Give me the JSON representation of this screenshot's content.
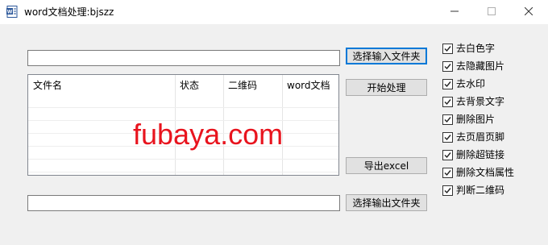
{
  "window": {
    "title": "word文档处理:bjszz"
  },
  "input_folder": {
    "value": "",
    "button_label": "选择输入文件夹"
  },
  "output_folder": {
    "value": "",
    "button_label": "选择输出文件夹"
  },
  "actions": {
    "start_label": "开始处理",
    "export_label": "导出excel"
  },
  "table": {
    "columns": [
      "文件名",
      "状态",
      "二维码",
      "word文档"
    ],
    "rows": []
  },
  "watermark": "fubaya.com",
  "options": [
    {
      "label": "去白色字",
      "checked": true
    },
    {
      "label": "去隐藏图片",
      "checked": true
    },
    {
      "label": "去水印",
      "checked": true
    },
    {
      "label": "去背景文字",
      "checked": true
    },
    {
      "label": "删除图片",
      "checked": true
    },
    {
      "label": "去页眉页脚",
      "checked": true
    },
    {
      "label": "删除超链接",
      "checked": true
    },
    {
      "label": "删除文档属性",
      "checked": true
    },
    {
      "label": "判断二维码",
      "checked": true
    }
  ]
}
